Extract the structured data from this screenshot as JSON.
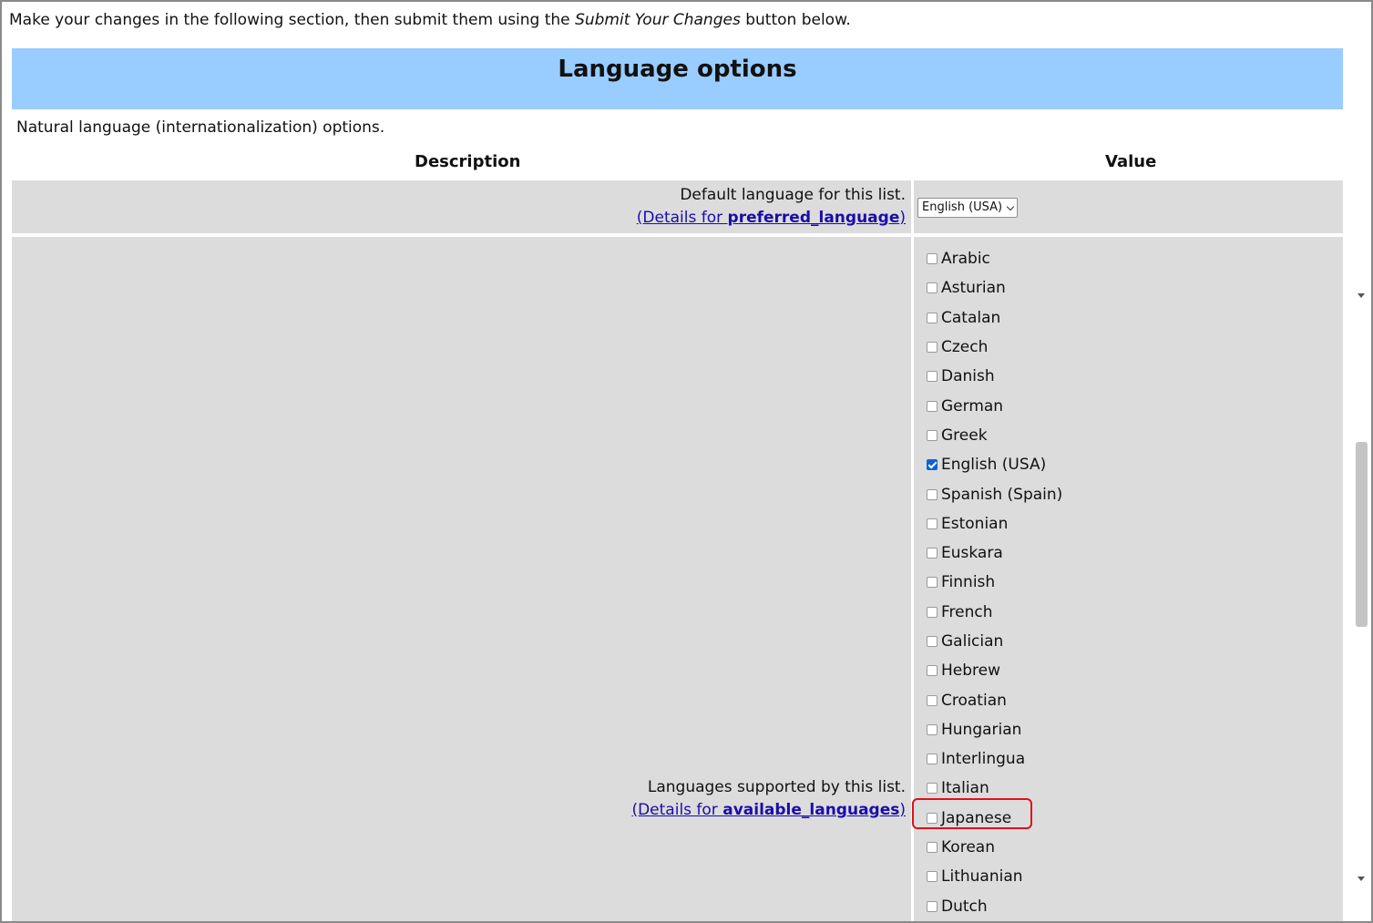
{
  "intro": {
    "before": "Make your changes in the following section, then submit them using the ",
    "emphasis": "Submit Your Changes",
    "after": " button below."
  },
  "section": {
    "title": "Language options",
    "description": "Natural language (internationalization) options."
  },
  "columns": {
    "description": "Description",
    "value": "Value"
  },
  "preferred_language": {
    "label": "Default language for this list.",
    "details_prefix": "(Details for ",
    "details_link": "preferred_language",
    "details_suffix": ")",
    "selected": "English (USA)"
  },
  "available_languages": {
    "label": "Languages supported by this list.",
    "details_prefix": "(Details for ",
    "details_link": "available_languages",
    "details_suffix": ")",
    "options": [
      {
        "label": "Arabic",
        "checked": false
      },
      {
        "label": "Asturian",
        "checked": false
      },
      {
        "label": "Catalan",
        "checked": false
      },
      {
        "label": "Czech",
        "checked": false
      },
      {
        "label": "Danish",
        "checked": false
      },
      {
        "label": "German",
        "checked": false
      },
      {
        "label": "Greek",
        "checked": false
      },
      {
        "label": "English (USA)",
        "checked": true
      },
      {
        "label": "Spanish (Spain)",
        "checked": false
      },
      {
        "label": "Estonian",
        "checked": false
      },
      {
        "label": "Euskara",
        "checked": false
      },
      {
        "label": "Finnish",
        "checked": false
      },
      {
        "label": "French",
        "checked": false
      },
      {
        "label": "Galician",
        "checked": false
      },
      {
        "label": "Hebrew",
        "checked": false
      },
      {
        "label": "Croatian",
        "checked": false
      },
      {
        "label": "Hungarian",
        "checked": false
      },
      {
        "label": "Interlingua",
        "checked": false
      },
      {
        "label": "Italian",
        "checked": false
      },
      {
        "label": "Japanese",
        "checked": false
      },
      {
        "label": "Korean",
        "checked": false
      },
      {
        "label": "Lithuanian",
        "checked": false
      },
      {
        "label": "Dutch",
        "checked": false
      }
    ]
  },
  "colors": {
    "header_bg": "#99ccff",
    "row_bg": "#dcdcdc",
    "link": "#1a0dab",
    "highlight": "#e0101a",
    "checkbox_checked": "#0b63d6"
  }
}
